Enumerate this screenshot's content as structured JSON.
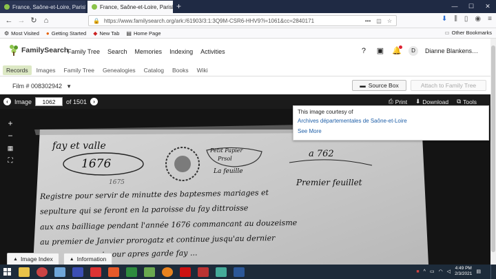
{
  "browser": {
    "tabs": [
      {
        "title": "France, Saône-et-Loire, Parish",
        "active": false
      },
      {
        "title": "France, Saône-et-Loire, Parish",
        "active": true
      }
    ],
    "new_tab": "+",
    "url": "https://www.familysearch.org/ark:/61903/3:1:3Q9M-CSR6-HHV9?i=1061&cc=2840171",
    "url_menu": "•••"
  },
  "bookmarks": {
    "items": [
      "Most Visited",
      "Getting Started",
      "New Tab",
      "Home Page"
    ],
    "other": "Other Bookmarks"
  },
  "header": {
    "logo": "FamilySearch",
    "nav": [
      "Family Tree",
      "Search",
      "Memories",
      "Indexing",
      "Activities"
    ],
    "avatar_initial": "D",
    "user_name": "Dianne Blankens…"
  },
  "subnav": {
    "items": [
      "Records",
      "Images",
      "Family Tree",
      "Genealogies",
      "Catalog",
      "Books",
      "Wiki"
    ]
  },
  "filmbar": {
    "film": "Film # 008302942",
    "source_box": "Source Box",
    "attach": "Attach to Family Tree"
  },
  "viewer": {
    "image_label": "Image",
    "image_number": "1062",
    "of_label": "of 1501",
    "print": "Print",
    "download": "Download",
    "tools": "Tools"
  },
  "courtesy": {
    "line": "This image courtesy of",
    "archive": "Archives départementales de Saône-et-Loire",
    "see_more": "See More"
  },
  "document_text": {
    "line1": "fay et valle",
    "year": "1676",
    "stamp1": "Petit Papier",
    "stamp2": "Prsol",
    "stamp3": "La feuille",
    "folio": "a 762",
    "number": "1675",
    "premier": "Premier feuillet",
    "l1": "Registre pour servir de minutte des baptesmes mariages et",
    "l2": "sepulture qui se feront en la paroisse du fay dittroisse",
    "l3": "aux ans bailliage pendant l'année 1676 commancant au douzeisme",
    "l4": "au premier de Janvier prorogatz et continue jusqu'au dernier",
    "l5": "quant pour apres garde fay ..."
  },
  "bottom_tabs": [
    "Image Index",
    "Information"
  ],
  "taskbar": {
    "time": "4:49 PM",
    "date": "2/3/2021"
  },
  "colors": {
    "brand_green": "#8bc34a",
    "link_blue": "#1f5fa8",
    "viewer_bg": "#141414",
    "subnav_active": "#dce8c4"
  }
}
